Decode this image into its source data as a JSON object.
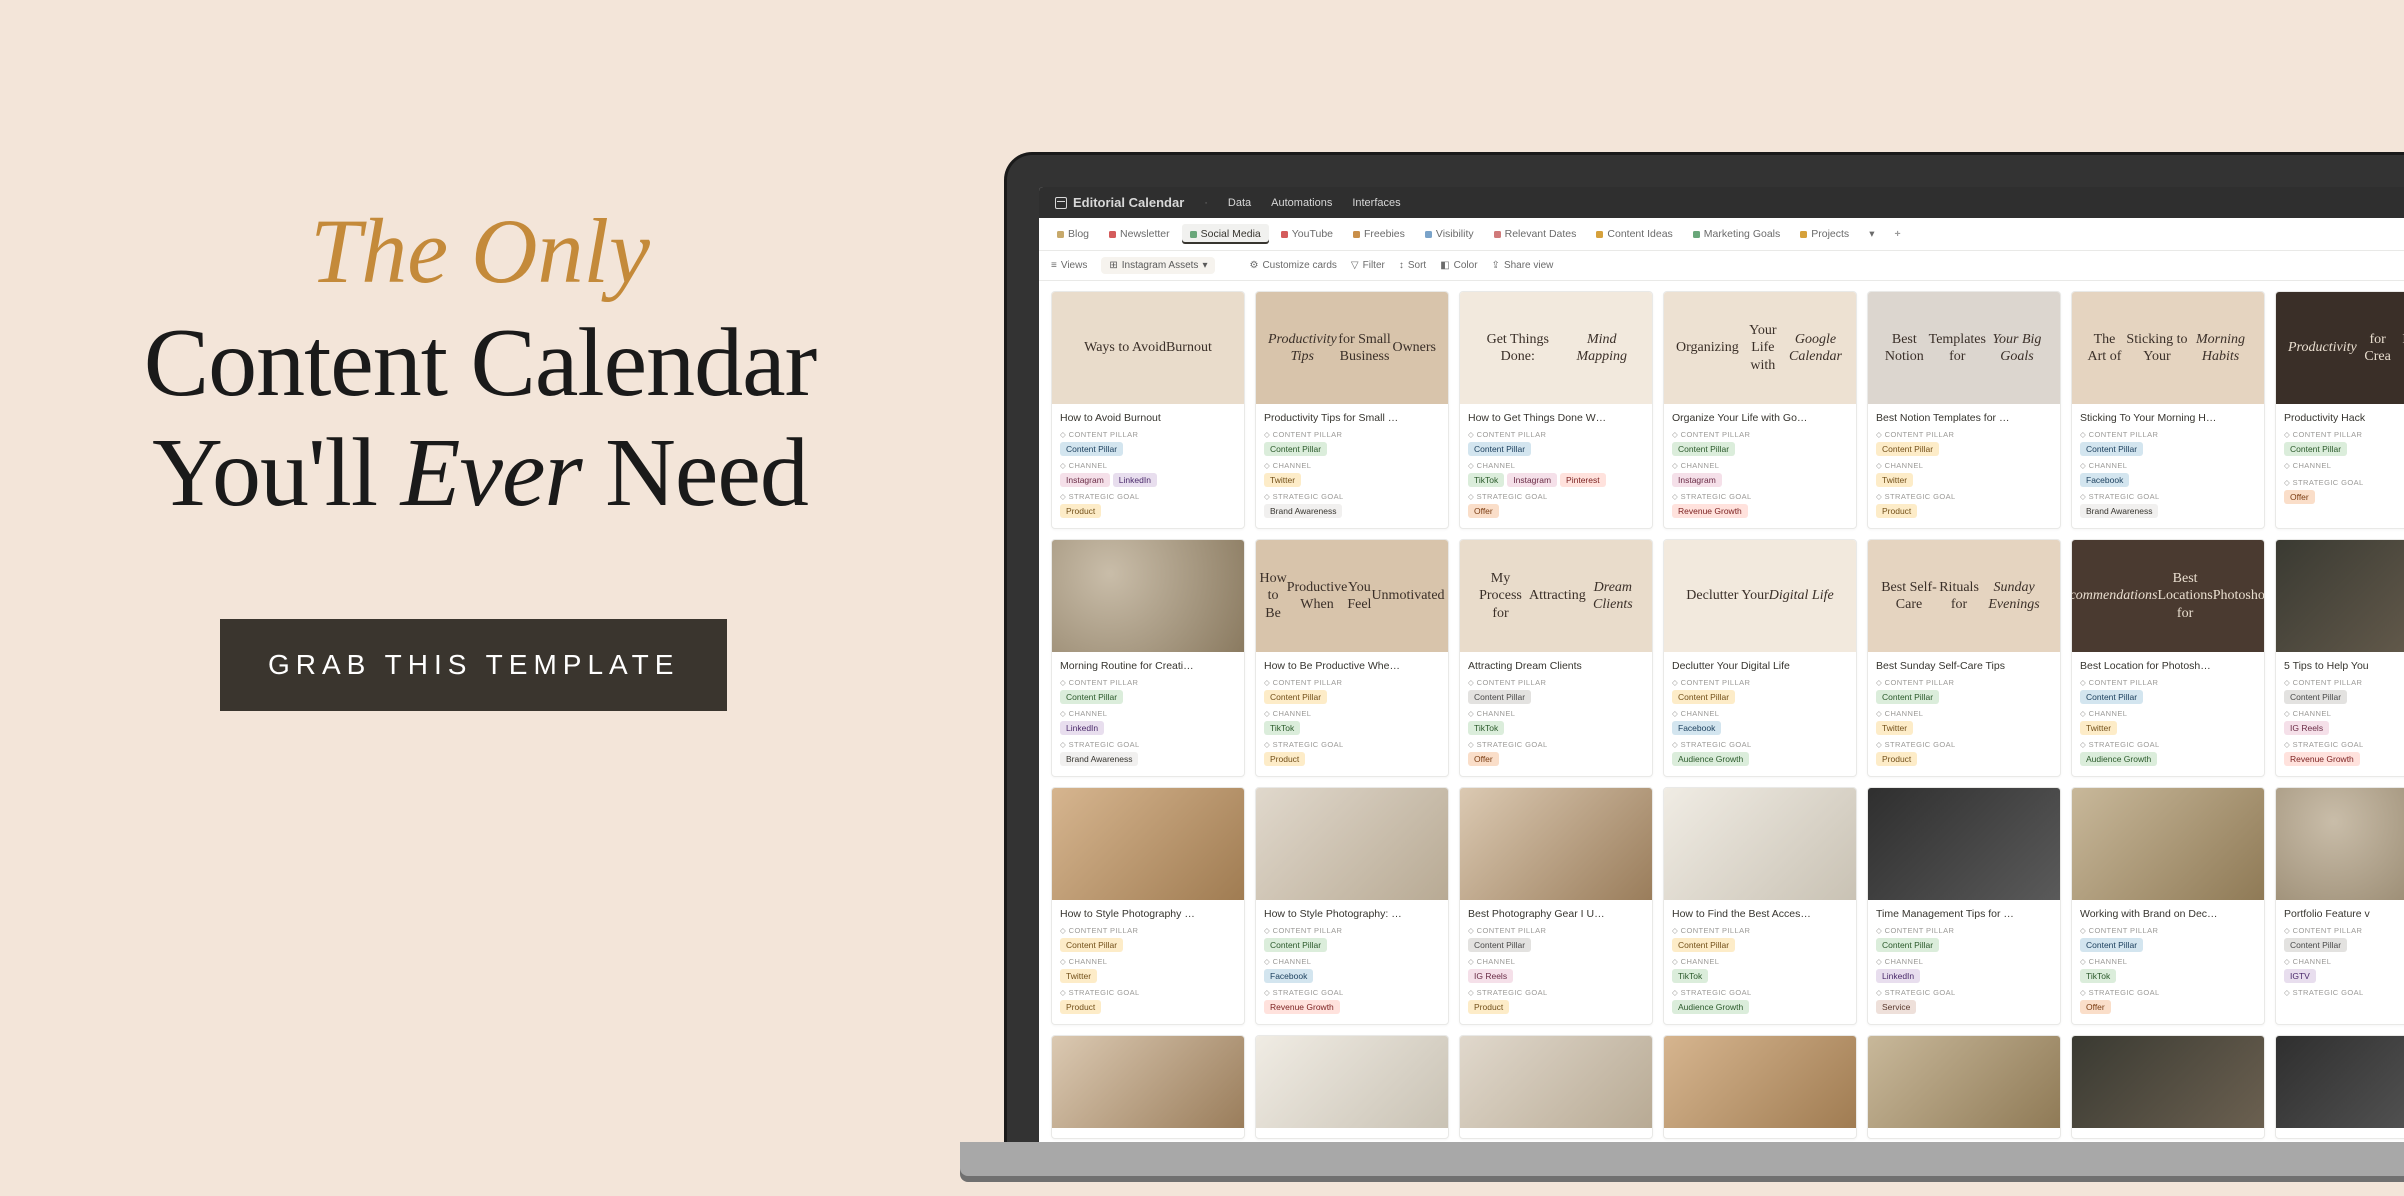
{
  "hero": {
    "accent": "The Only",
    "line1": "Content Calendar",
    "line2a": "You'll ",
    "line2_em": "Ever",
    "line2b": " Need",
    "cta": "GRAB THIS TEMPLATE"
  },
  "app": {
    "header": {
      "title": "Editorial Calendar",
      "meta": [
        "Data",
        "Automations",
        "Interfaces"
      ]
    },
    "views": [
      {
        "label": "Blog",
        "color": "#c7a96b"
      },
      {
        "label": "Newsletter",
        "color": "#d45b5b"
      },
      {
        "label": "Social Media",
        "color": "#6aa77a",
        "active": true
      },
      {
        "label": "YouTube",
        "color": "#d45b5b"
      },
      {
        "label": "Freebies",
        "color": "#c98f4a"
      },
      {
        "label": "Visibility",
        "color": "#7aa3c9"
      },
      {
        "label": "Relevant Dates",
        "color": "#d07a7a"
      },
      {
        "label": "Content Ideas",
        "color": "#d6a13b"
      },
      {
        "label": "Marketing Goals",
        "color": "#6aa77a"
      },
      {
        "label": "Projects",
        "color": "#d6a13b"
      }
    ],
    "toolbar": {
      "views": "Views",
      "assets": "Instagram Assets",
      "customize": "Customize cards",
      "filter": "Filter",
      "sort": "Sort",
      "color": "Color",
      "share": "Share view"
    },
    "prop_labels": {
      "pillar": "CONTENT PILLAR",
      "channel": "CHANNEL",
      "goal": "STRATEGIC GOAL"
    },
    "cards": [
      [
        {
          "thumb": {
            "type": "text",
            "bg": "bg-beige",
            "lines": [
              "Ways to Avoid",
              "Burnout"
            ]
          },
          "title": "How to Avoid Burnout",
          "pillar": {
            "label": "Content Pillar",
            "c": "c-blue"
          },
          "channels": [
            {
              "label": "Instagram",
              "c": "c-pink"
            },
            {
              "label": "LinkedIn",
              "c": "c-purple"
            }
          ],
          "goal": {
            "label": "Product",
            "c": "c-yellow"
          }
        },
        {
          "thumb": {
            "type": "text",
            "bg": "bg-tan",
            "lines": [
              "Productivity Tips",
              "for Small Business",
              "Owners"
            ],
            "em": [
              0
            ]
          },
          "title": "Productivity Tips for Small …",
          "pillar": {
            "label": "Content Pillar",
            "c": "c-green"
          },
          "channels": [
            {
              "label": "Twitter",
              "c": "c-yellow"
            }
          ],
          "goal": {
            "label": "Brand Awareness",
            "c": "c-default"
          }
        },
        {
          "thumb": {
            "type": "text",
            "bg": "bg-cream",
            "lines": [
              "Get Things Done:",
              "Mind Mapping"
            ],
            "em": [
              1
            ]
          },
          "title": "How to Get Things Done W…",
          "pillar": {
            "label": "Content Pillar",
            "c": "c-blue"
          },
          "channels": [
            {
              "label": "TikTok",
              "c": "c-green"
            },
            {
              "label": "Instagram",
              "c": "c-pink"
            },
            {
              "label": "Pinterest",
              "c": "c-red"
            }
          ],
          "goal": {
            "label": "Offer",
            "c": "c-orange"
          }
        },
        {
          "thumb": {
            "type": "text",
            "bg": "bg-beige2",
            "lines": [
              "Organizing",
              "Your Life with",
              "Google Calendar"
            ],
            "em": [
              2
            ]
          },
          "title": "Organize Your Life with Go…",
          "pillar": {
            "label": "Content Pillar",
            "c": "c-green"
          },
          "channels": [
            {
              "label": "Instagram",
              "c": "c-pink"
            }
          ],
          "goal": {
            "label": "Revenue Growth",
            "c": "c-red"
          }
        },
        {
          "thumb": {
            "type": "text",
            "bg": "bg-grayp",
            "lines": [
              "Best Notion",
              "Templates for",
              "Your Big Goals"
            ],
            "em": [
              2
            ]
          },
          "title": "Best Notion Templates for …",
          "pillar": {
            "label": "Content Pillar",
            "c": "c-yellow"
          },
          "channels": [
            {
              "label": "Twitter",
              "c": "c-yellow"
            }
          ],
          "goal": {
            "label": "Product",
            "c": "c-yellow"
          }
        },
        {
          "thumb": {
            "type": "text",
            "bg": "bg-warm",
            "lines": [
              "The Art of",
              "Sticking to Your",
              "Morning Habits"
            ],
            "em": [
              2
            ]
          },
          "title": "Sticking To Your Morning H…",
          "pillar": {
            "label": "Content Pillar",
            "c": "c-blue"
          },
          "channels": [
            {
              "label": "Facebook",
              "c": "c-blue"
            }
          ],
          "goal": {
            "label": "Brand Awareness",
            "c": "c-default"
          }
        },
        {
          "thumb": {
            "type": "text",
            "bg": "bg-dark",
            "lines": [
              "Productivity",
              "for Crea",
              "Business O"
            ],
            "em": [
              0
            ]
          },
          "title": "Productivity Hack",
          "pillar": {
            "label": "Content Pillar",
            "c": "c-green"
          },
          "channels": [],
          "goal": {
            "label": "Offer",
            "c": "c-orange"
          }
        }
      ],
      [
        {
          "thumb": {
            "type": "photo",
            "bg": "bg-photo1"
          },
          "title": "Morning Routine for Creati…",
          "pillar": {
            "label": "Content Pillar",
            "c": "c-green"
          },
          "channels": [
            {
              "label": "LinkedIn",
              "c": "c-purple"
            }
          ],
          "goal": {
            "label": "Brand Awareness",
            "c": "c-default"
          }
        },
        {
          "thumb": {
            "type": "text",
            "bg": "bg-tan",
            "lines": [
              "How to Be",
              "Productive When",
              "You Feel",
              "Unmotivated"
            ]
          },
          "title": "How to Be Productive Whe…",
          "pillar": {
            "label": "Content Pillar",
            "c": "c-yellow"
          },
          "channels": [
            {
              "label": "TikTok",
              "c": "c-green"
            }
          ],
          "goal": {
            "label": "Product",
            "c": "c-yellow"
          }
        },
        {
          "thumb": {
            "type": "text",
            "bg": "bg-beige",
            "lines": [
              "My Process for",
              "Attracting",
              "Dream Clients"
            ],
            "em": [
              2
            ]
          },
          "title": "Attracting Dream Clients",
          "pillar": {
            "label": "Content Pillar",
            "c": "c-gray"
          },
          "channels": [
            {
              "label": "TikTok",
              "c": "c-green"
            }
          ],
          "goal": {
            "label": "Offer",
            "c": "c-orange"
          }
        },
        {
          "thumb": {
            "type": "text",
            "bg": "bg-cream",
            "lines": [
              "Declutter Your",
              "Digital Life"
            ],
            "em": [
              1
            ]
          },
          "title": "Declutter Your Digital Life",
          "pillar": {
            "label": "Content Pillar",
            "c": "c-yellow"
          },
          "channels": [
            {
              "label": "Facebook",
              "c": "c-blue"
            }
          ],
          "goal": {
            "label": "Audience Growth",
            "c": "c-green"
          }
        },
        {
          "thumb": {
            "type": "text",
            "bg": "bg-warm",
            "lines": [
              "Best Self-Care",
              "Rituals for",
              "Sunday Evenings"
            ],
            "em": [
              2
            ]
          },
          "title": "Best Sunday Self-Care Tips",
          "pillar": {
            "label": "Content Pillar",
            "c": "c-green"
          },
          "channels": [
            {
              "label": "Twitter",
              "c": "c-yellow"
            }
          ],
          "goal": {
            "label": "Product",
            "c": "c-yellow"
          }
        },
        {
          "thumb": {
            "type": "text",
            "bg": "bg-dark2",
            "lines": [
              "Recommendations",
              "Best Locations for",
              "Photoshoots"
            ],
            "em": [
              0
            ]
          },
          "title": "Best Location for Photosh…",
          "pillar": {
            "label": "Content Pillar",
            "c": "c-blue"
          },
          "channels": [
            {
              "label": "Twitter",
              "c": "c-yellow"
            }
          ],
          "goal": {
            "label": "Audience Growth",
            "c": "c-green"
          }
        },
        {
          "thumb": {
            "type": "photo",
            "bg": "bg-photo2"
          },
          "title": "5 Tips to Help You",
          "pillar": {
            "label": "Content Pillar",
            "c": "c-gray"
          },
          "channels": [
            {
              "label": "IG Reels",
              "c": "c-pink"
            }
          ],
          "goal": {
            "label": "Revenue Growth",
            "c": "c-red"
          }
        }
      ],
      [
        {
          "thumb": {
            "type": "photo",
            "bg": "bg-photo3"
          },
          "title": "How to Style Photography …",
          "pillar": {
            "label": "Content Pillar",
            "c": "c-yellow"
          },
          "channels": [
            {
              "label": "Twitter",
              "c": "c-yellow"
            }
          ],
          "goal": {
            "label": "Product",
            "c": "c-yellow"
          }
        },
        {
          "thumb": {
            "type": "photo",
            "bg": "bg-photo4"
          },
          "title": "How to Style Photography: …",
          "pillar": {
            "label": "Content Pillar",
            "c": "c-green"
          },
          "channels": [
            {
              "label": "Facebook",
              "c": "c-blue"
            }
          ],
          "goal": {
            "label": "Revenue Growth",
            "c": "c-red"
          }
        },
        {
          "thumb": {
            "type": "photo",
            "bg": "bg-photo6"
          },
          "title": "Best Photography Gear I U…",
          "pillar": {
            "label": "Content Pillar",
            "c": "c-gray"
          },
          "channels": [
            {
              "label": "IG Reels",
              "c": "c-pink"
            }
          ],
          "goal": {
            "label": "Product",
            "c": "c-yellow"
          }
        },
        {
          "thumb": {
            "type": "photo",
            "bg": "bg-photo7"
          },
          "title": "How to Find the Best Acces…",
          "pillar": {
            "label": "Content Pillar",
            "c": "c-yellow"
          },
          "channels": [
            {
              "label": "TikTok",
              "c": "c-green"
            }
          ],
          "goal": {
            "label": "Audience Growth",
            "c": "c-green"
          }
        },
        {
          "thumb": {
            "type": "photo",
            "bg": "bg-photo5"
          },
          "title": "Time Management Tips for …",
          "pillar": {
            "label": "Content Pillar",
            "c": "c-green"
          },
          "channels": [
            {
              "label": "LinkedIn",
              "c": "c-purple"
            }
          ],
          "goal": {
            "label": "Service",
            "c": "c-brown"
          }
        },
        {
          "thumb": {
            "type": "photo",
            "bg": "bg-photo8"
          },
          "title": "Working with Brand on Dec…",
          "pillar": {
            "label": "Content Pillar",
            "c": "c-blue"
          },
          "channels": [
            {
              "label": "TikTok",
              "c": "c-green"
            }
          ],
          "goal": {
            "label": "Offer",
            "c": "c-orange"
          }
        },
        {
          "thumb": {
            "type": "photo",
            "bg": "bg-photo1"
          },
          "title": "Portfolio Feature v",
          "pillar": {
            "label": "Content Pillar",
            "c": "c-gray"
          },
          "channels": [
            {
              "label": "IGTV",
              "c": "c-purple"
            }
          ],
          "goal": {
            "label": "",
            "c": "c-default"
          }
        }
      ],
      [
        {
          "thumb": {
            "type": "photo",
            "bg": "bg-photo6"
          }
        },
        {
          "thumb": {
            "type": "photo",
            "bg": "bg-photo7"
          }
        },
        {
          "thumb": {
            "type": "photo",
            "bg": "bg-photo4"
          }
        },
        {
          "thumb": {
            "type": "photo",
            "bg": "bg-photo3"
          }
        },
        {
          "thumb": {
            "type": "photo",
            "bg": "bg-photo8"
          }
        },
        {
          "thumb": {
            "type": "photo",
            "bg": "bg-photo2"
          }
        },
        {
          "thumb": {
            "type": "photo",
            "bg": "bg-photo5"
          }
        }
      ]
    ]
  }
}
